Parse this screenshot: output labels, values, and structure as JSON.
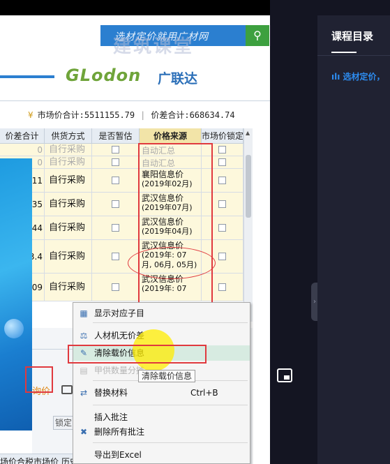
{
  "banner": {
    "text": "选材定价就用广材网",
    "watermark": "建筑课堂",
    "brand_logo": "GLodon",
    "brand_cn": "广联达"
  },
  "totals": {
    "market_label": "市场价合计:5511155.79",
    "diff_label": "价差合计:668634.74",
    "separator": "|"
  },
  "table": {
    "headers": [
      "价差合计",
      "供货方式",
      "是否暂估",
      "价格来源",
      "市场价锁定"
    ],
    "rows": [
      {
        "diff": "0",
        "supply": "自行采购",
        "source_1": "自动汇总",
        "source_2": "",
        "gray": true
      },
      {
        "diff": "0",
        "supply": "自行采购",
        "source_1": "自动汇总",
        "source_2": "",
        "gray": true
      },
      {
        "diff": "11",
        "supply": "自行采购",
        "source_1": "襄阳信息价",
        "source_2": "(2019年02月)",
        "gray": false
      },
      {
        "diff": "35",
        "supply": "自行采购",
        "source_1": "武汉信息价",
        "source_2": "(2019年07月)",
        "gray": false
      },
      {
        "diff": "44",
        "supply": "自行采购",
        "source_1": "武汉信息价",
        "source_2": "(2019年04月)",
        "gray": false
      },
      {
        "diff": "3.4",
        "supply": "自行采购",
        "source_1": "武汉信息价",
        "source_2": "(2019年: 07",
        "source_3": "月, 06月, 05月)",
        "gray": false
      },
      {
        "diff": "09",
        "supply": "自行采购",
        "source_1": "武汉信息价",
        "source_2": "(2019年: 07",
        "gray": false
      }
    ]
  },
  "lower": {
    "price_tab": "询价",
    "lock_btn": "锁定",
    "bottom_header": "场价合税市场价 历史"
  },
  "context_menu": {
    "items": [
      {
        "label": "显示对应子目",
        "icon": "tree-icon",
        "disabled": false
      },
      {
        "label": "人材机无价差",
        "icon": "scale-icon",
        "disabled": false
      },
      {
        "label": "清除载价信息",
        "icon": "clear-price-icon",
        "disabled": false,
        "hover": true
      },
      {
        "label": "甲供数量分摊",
        "icon": "split-icon",
        "disabled": true
      },
      {
        "label": "替换材料",
        "icon": "replace-icon",
        "shortcut": "Ctrl+B",
        "disabled": false
      },
      {
        "label": "插入批注",
        "icon": "",
        "disabled": false
      },
      {
        "label": "删除所有批注",
        "icon": "delete-note-icon",
        "disabled": false
      },
      {
        "label": "导出到Excel",
        "icon": "",
        "disabled": false
      }
    ],
    "tooltip": "清除载价信息"
  },
  "panel": {
    "title": "课程目录",
    "item": "选材定价，"
  },
  "colors": {
    "accent_blue": "#2b7fd0",
    "annotation_red": "#e0393e",
    "cell_yellow": "#fdf8dc",
    "panel_dark": "#202232"
  }
}
